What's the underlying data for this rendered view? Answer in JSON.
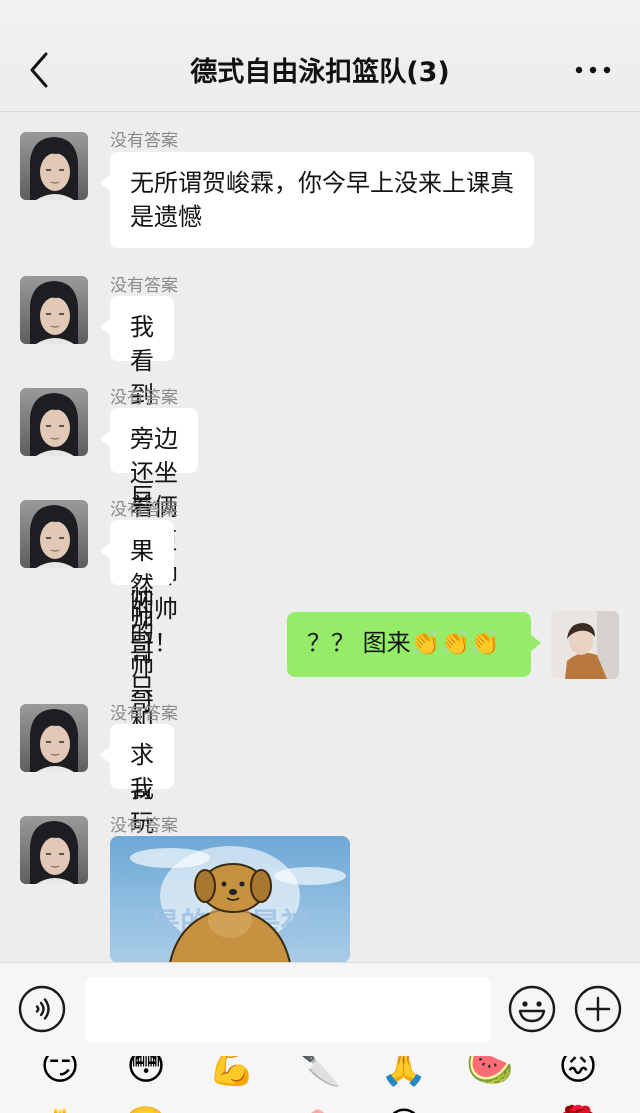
{
  "header": {
    "title": "德式自由泳扣篮队(3)"
  },
  "chat": {
    "messages": [
      {
        "sender": "没有答案",
        "text": "无所谓贺峻霖，你今早上没来上课真是遗憾"
      },
      {
        "sender": "没有答案",
        "text": "我看到一个巨巨巨帅的帅哥"
      },
      {
        "sender": "没有答案",
        "text": "旁边还坐着俩巨巨巨帅的帅哥！"
      },
      {
        "sender": "没有答案",
        "text": "果然帅哥只和帅哥玩"
      },
      {
        "sender": "self",
        "text": "？？ 图来👏👏👏"
      },
      {
        "sender": "没有答案",
        "text": "求我"
      },
      {
        "sender": "没有答案",
        "sticker_text": "是的 我是神"
      }
    ]
  },
  "input": {
    "value": "",
    "placeholder": ""
  },
  "emoji_panel": {
    "row1": [
      "😏",
      "😳",
      "💪",
      "🔪",
      "🙏",
      "🍉",
      "😖"
    ],
    "row2": [
      "🎂",
      "🙂",
      "🐽",
      "😃",
      "🌹",
      "🐷"
    ]
  },
  "colors": {
    "accent_green": "#95ec69",
    "chat_background": "#ededed"
  }
}
